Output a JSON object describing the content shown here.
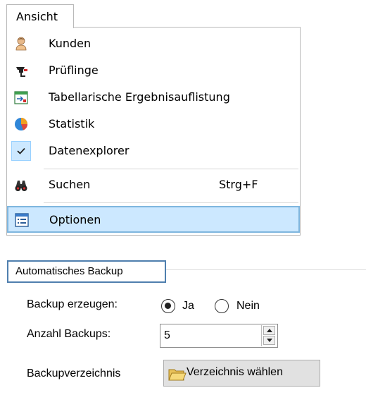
{
  "menu": {
    "title": "Ansicht",
    "items": [
      {
        "label": "Kunden",
        "icon": "person-icon"
      },
      {
        "label": "Prüflinge",
        "icon": "test-device-icon"
      },
      {
        "label": "Tabellarische Ergebnisauflistung",
        "icon": "table-calendar-icon"
      },
      {
        "label": "Statistik",
        "icon": "pie-chart-icon"
      },
      {
        "label": "Datenexplorer",
        "icon": "check-icon",
        "checked": true
      },
      {
        "label": "Suchen",
        "icon": "binoculars-icon",
        "shortcut": "Strg+F"
      },
      {
        "label": "Optionen",
        "icon": "options-list-icon",
        "selected": true
      }
    ]
  },
  "backup": {
    "group_title": "Automatisches Backup",
    "create_label": "Backup erzeugen:",
    "radio_yes": "Ja",
    "radio_no": "Nein",
    "selected": "Ja",
    "count_label": "Anzahl Backups:",
    "count_value": "5",
    "dir_label": "Backupverzeichnis",
    "choose_dir_button": "Verzeichnis wählen"
  },
  "colors": {
    "highlight": "#cce8ff",
    "highlight_border": "#7fb6de",
    "group_title_border": "#4f7fae"
  }
}
